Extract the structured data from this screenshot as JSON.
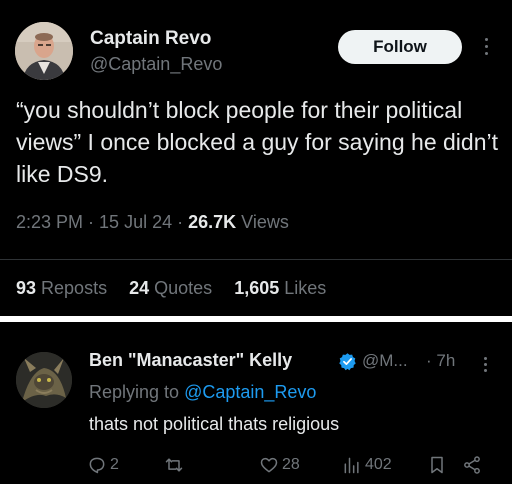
{
  "tweet": {
    "author_name": "Captain Revo",
    "author_handle": "@Captain_Revo",
    "follow_label": "Follow",
    "text": "“you shouldn’t block people for their political views” I once blocked a guy for saying he didn’t like DS9.",
    "time": "2:23 PM",
    "sep1": " · ",
    "date": "15 Jul 24",
    "sep2": " · ",
    "views_count": "26.7K",
    "views_label": "Views",
    "reposts_count": "93",
    "reposts_label": "Reposts",
    "quotes_count": "24",
    "quotes_label": "Quotes",
    "likes_count": "1,605",
    "likes_label": "Likes"
  },
  "reply": {
    "author_name": "Ben \"Manacaster\" Kelly",
    "author_handle": "@M...",
    "time": "· 7h",
    "replying_prefix": "Replying to ",
    "replying_to": "@Captain_Revo",
    "text": "thats not political thats religious",
    "reply_count": "2",
    "like_count": "28",
    "view_count": "402"
  },
  "colors": {
    "background": "#000000",
    "text": "#e7e9ea",
    "muted": "#71767b",
    "link": "#1d9bf0",
    "follow_bg": "#eff3f4"
  },
  "icons": [
    "more-icon",
    "verified-icon",
    "reply-icon",
    "repost-icon",
    "like-icon",
    "views-icon",
    "bookmark-icon",
    "share-icon"
  ]
}
